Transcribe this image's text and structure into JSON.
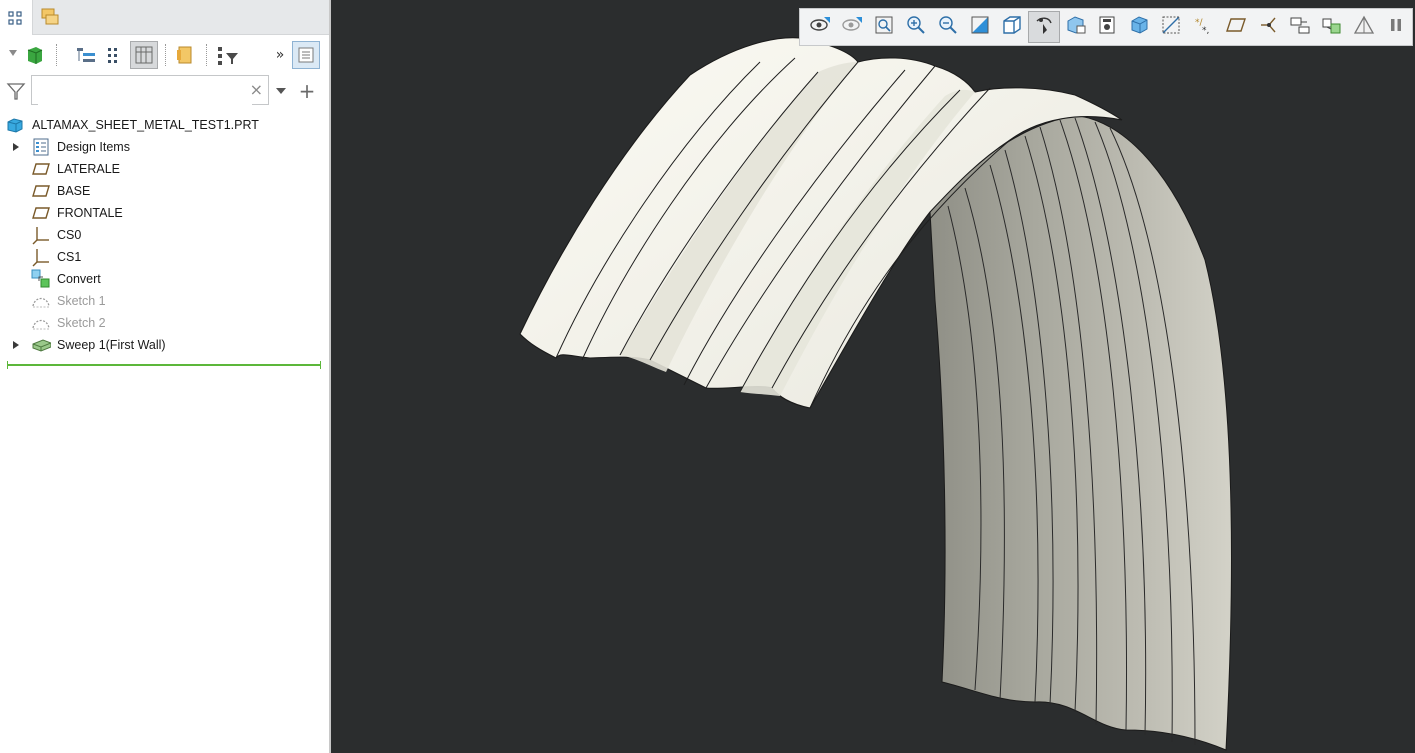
{
  "model_tree": {
    "tabs": [
      {
        "name": "model-tree-tab",
        "icon": "model-tree-icon",
        "active": true
      },
      {
        "name": "layers-tab",
        "icon": "layers-icon",
        "active": false
      }
    ],
    "toolbar": {
      "more_label": "»"
    },
    "search": {
      "value": "",
      "placeholder": "",
      "clear_label": "×",
      "add_label": "+"
    },
    "root": {
      "label": "ALTAMAX_SHEET_METAL_TEST1.PRT",
      "icon": "part-icon"
    },
    "items": [
      {
        "label": "Design Items",
        "icon": "design-items-icon",
        "expandable": true,
        "dim": false
      },
      {
        "label": "LATERALE",
        "icon": "datum-plane-icon",
        "expandable": false,
        "dim": false
      },
      {
        "label": "BASE",
        "icon": "datum-plane-icon",
        "expandable": false,
        "dim": false
      },
      {
        "label": "FRONTALE",
        "icon": "datum-plane-icon",
        "expandable": false,
        "dim": false
      },
      {
        "label": "CS0",
        "icon": "coordinate-system-icon",
        "expandable": false,
        "dim": false
      },
      {
        "label": "CS1",
        "icon": "coordinate-system-icon",
        "expandable": false,
        "dim": false
      },
      {
        "label": "Convert",
        "icon": "convert-icon",
        "expandable": false,
        "dim": false
      },
      {
        "label": "Sketch 1",
        "icon": "sketch-icon",
        "expandable": false,
        "dim": true
      },
      {
        "label": "Sketch 2",
        "icon": "sketch-icon",
        "expandable": false,
        "dim": true
      },
      {
        "label": "Sweep 1(First Wall)",
        "icon": "sweep-wall-icon",
        "expandable": true,
        "dim": false
      }
    ]
  },
  "graphics_toolbar": {
    "buttons": [
      "show-icon",
      "hide-icon",
      "refit-icon",
      "zoom-in-icon",
      "zoom-out-icon",
      "repaint-icon",
      "display-style-icon",
      "spin-center-icon",
      "saved-orientations-icon",
      "view-manager-icon",
      "named-views-icon",
      "datum-display-icon",
      "annotation-display-icon",
      "plane-display-icon",
      "point-display-icon",
      "csys-display-icon",
      "appearance-icon",
      "perspective-icon",
      "pause-icon"
    ]
  },
  "colors": {
    "viewport_bg": "#2b2d2e",
    "outer_surface": "#f4f3ea",
    "inner_surface": "#9d9d93",
    "insert_marker": "#5cb73a"
  }
}
